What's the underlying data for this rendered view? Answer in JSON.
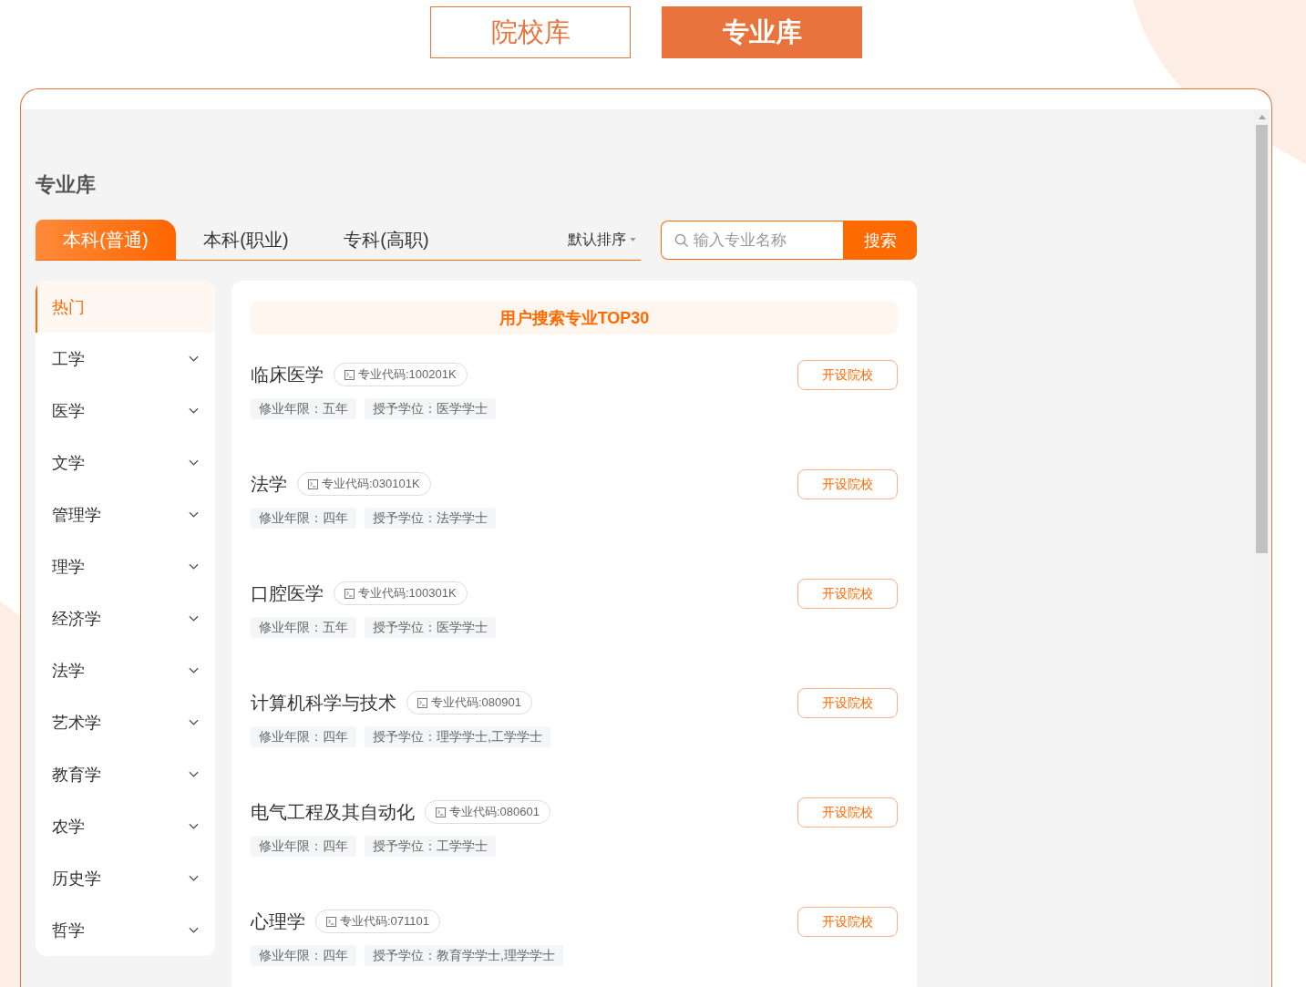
{
  "mode_switch": [
    {
      "label": "院校库",
      "selected": false
    },
    {
      "label": "专业库",
      "selected": true
    }
  ],
  "panel": {
    "title": "专业库",
    "tabs": [
      {
        "label": "本科(普通)",
        "selected": true
      },
      {
        "label": "本科(职业)",
        "selected": false
      },
      {
        "label": "专科(高职)",
        "selected": false
      }
    ],
    "sort": {
      "label": "默认排序"
    },
    "search": {
      "placeholder": "输入专业名称",
      "button": "搜索"
    },
    "categories": [
      {
        "label": "热门",
        "selected": true,
        "expandable": false
      },
      {
        "label": "工学",
        "selected": false,
        "expandable": true
      },
      {
        "label": "医学",
        "selected": false,
        "expandable": true
      },
      {
        "label": "文学",
        "selected": false,
        "expandable": true
      },
      {
        "label": "管理学",
        "selected": false,
        "expandable": true
      },
      {
        "label": "理学",
        "selected": false,
        "expandable": true
      },
      {
        "label": "经济学",
        "selected": false,
        "expandable": true
      },
      {
        "label": "法学",
        "selected": false,
        "expandable": true
      },
      {
        "label": "艺术学",
        "selected": false,
        "expandable": true
      },
      {
        "label": "教育学",
        "selected": false,
        "expandable": true
      },
      {
        "label": "农学",
        "selected": false,
        "expandable": true
      },
      {
        "label": "历史学",
        "selected": false,
        "expandable": true
      },
      {
        "label": "哲学",
        "selected": false,
        "expandable": true
      }
    ],
    "list_title": "用户搜索专业TOP30",
    "majors": [
      {
        "name": "临床医学",
        "code": "专业代码:100201K",
        "duration": "修业年限：五年",
        "degree": "授予学位：医学学士",
        "button": "开设院校"
      },
      {
        "name": "法学",
        "code": "专业代码:030101K",
        "duration": "修业年限：四年",
        "degree": "授予学位：法学学士",
        "button": "开设院校"
      },
      {
        "name": "口腔医学",
        "code": "专业代码:100301K",
        "duration": "修业年限：五年",
        "degree": "授予学位：医学学士",
        "button": "开设院校"
      },
      {
        "name": "计算机科学与技术",
        "code": "专业代码:080901",
        "duration": "修业年限：四年",
        "degree": "授予学位：理学学士,工学学士",
        "button": "开设院校"
      },
      {
        "name": "电气工程及其自动化",
        "code": "专业代码:080601",
        "duration": "修业年限：四年",
        "degree": "授予学位：工学学士",
        "button": "开设院校"
      },
      {
        "name": "心理学",
        "code": "专业代码:071101",
        "duration": "修业年限：四年",
        "degree": "授予学位：教育学学士,理学学士",
        "button": "开设院校"
      }
    ]
  }
}
